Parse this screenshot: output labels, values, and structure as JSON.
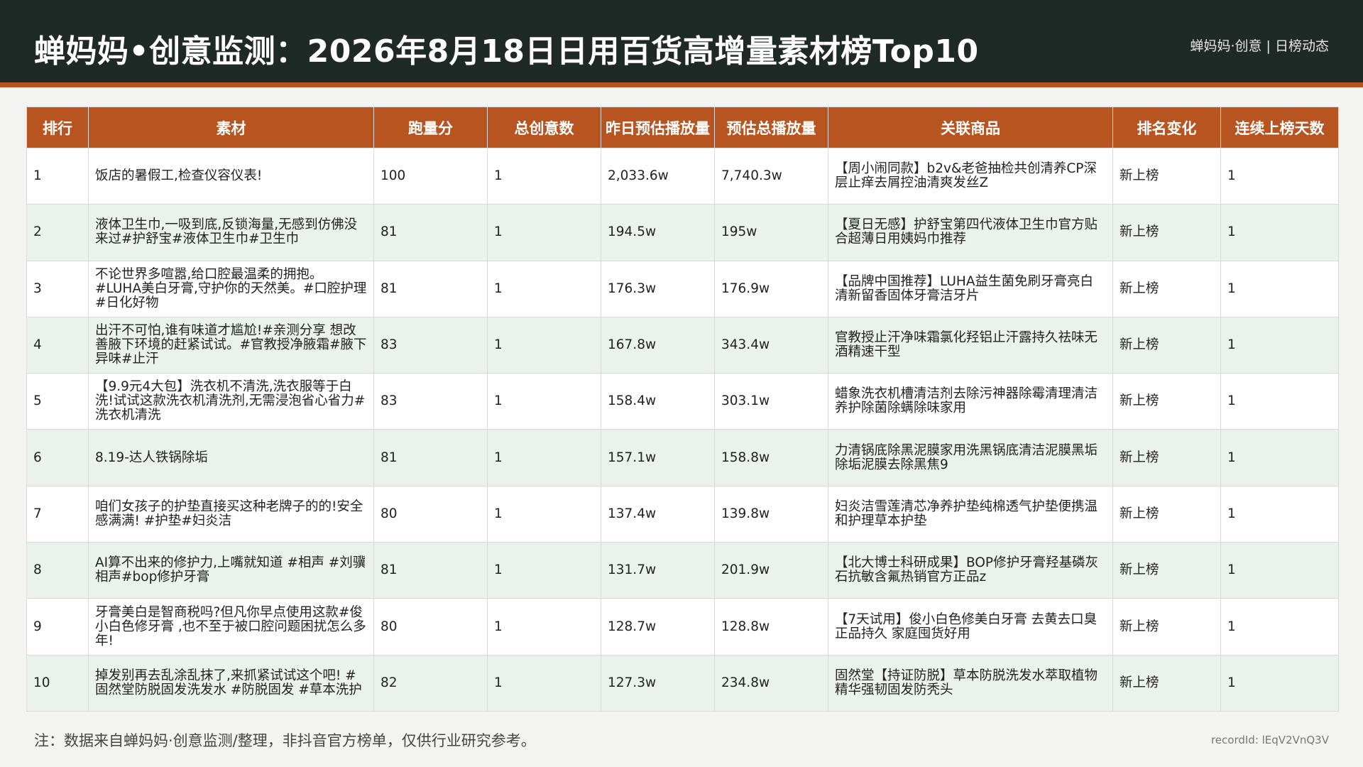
{
  "header": {
    "title": "蝉妈妈•创意监测：2026年8月18日日用百货高增量素材榜Top10",
    "right": "蝉妈妈·创意 | 日榜动态"
  },
  "table": {
    "columns": [
      "排行",
      "素材",
      "跑量分",
      "总创意数",
      "昨日预估播放量",
      "预估总播放量",
      "关联商品",
      "排名变化",
      "连续上榜天数"
    ],
    "rows": [
      {
        "rank": "1",
        "material": "饭店的暑假工,检查仪容仪表!",
        "score": "100",
        "creatives": "1",
        "yesterday_plays": "2,033.6w",
        "total_plays": "7,740.3w",
        "product": "【周小闹同款】b2v&老爸抽检共创清养CP深层止痒去屑控油清爽发丝Z",
        "rank_change": "新上榜",
        "streak_days": "1"
      },
      {
        "rank": "2",
        "material": "液体卫生巾,一吸到底,反锁海量,无感到仿佛没来过#护舒宝#液体卫生巾#卫生巾",
        "score": "81",
        "creatives": "1",
        "yesterday_plays": "194.5w",
        "total_plays": "195w",
        "product": "【夏日无感】护舒宝第四代液体卫生巾官方贴合超薄日用姨妈巾推荐",
        "rank_change": "新上榜",
        "streak_days": "1"
      },
      {
        "rank": "3",
        "material": "不论世界多喧嚣,给口腔最温柔的拥抱。#LUHA美白牙膏,守护你的天然美。#口腔护理 #日化好物",
        "score": "81",
        "creatives": "1",
        "yesterday_plays": "176.3w",
        "total_plays": "176.9w",
        "product": "【品牌中国推荐】LUHA益生菌免刷牙膏亮白清新留香固体牙膏洁牙片",
        "rank_change": "新上榜",
        "streak_days": "1"
      },
      {
        "rank": "4",
        "material": "出汗不可怕,谁有味道才尴尬!#亲测分享 想改善腋下环境的赶紧试试。#官教授净腋霜#腋下异味#止汗",
        "score": "83",
        "creatives": "1",
        "yesterday_plays": "167.8w",
        "total_plays": "343.4w",
        "product": "官教授止汗净味霜氯化羟铝止汗露持久祛味无酒精速干型",
        "rank_change": "新上榜",
        "streak_days": "1"
      },
      {
        "rank": "5",
        "material": "【9.9元4大包】洗衣机不清洗,洗衣服等于白洗!试试这款洗衣机清洗剂,无需浸泡省心省力#洗衣机清洗",
        "score": "83",
        "creatives": "1",
        "yesterday_plays": "158.4w",
        "total_plays": "303.1w",
        "product": "蜡象洗衣机槽清洁剂去除污神器除霉清理清洁养护除菌除螨除味家用",
        "rank_change": "新上榜",
        "streak_days": "1"
      },
      {
        "rank": "6",
        "material": "8.19-达人铁锅除垢",
        "score": "81",
        "creatives": "1",
        "yesterday_plays": "157.1w",
        "total_plays": "158.8w",
        "product": "力清锅底除黑泥膜家用洗黑锅底清洁泥膜黑垢除垢泥膜去除黑焦9",
        "rank_change": "新上榜",
        "streak_days": "1"
      },
      {
        "rank": "7",
        "material": "咱们女孩子的护垫直接买这种老牌子的的!安全感满满! #护垫#妇炎洁",
        "score": "80",
        "creatives": "1",
        "yesterday_plays": "137.4w",
        "total_plays": "139.8w",
        "product": "妇炎洁雪莲清芯净养护垫纯棉透气护垫便携温和护理草本护垫",
        "rank_change": "新上榜",
        "streak_days": "1"
      },
      {
        "rank": "8",
        "material": "AI算不出来的修护力,上嘴就知道 #相声 #刘骥相声#bop修护牙膏",
        "score": "81",
        "creatives": "1",
        "yesterday_plays": "131.7w",
        "total_plays": "201.9w",
        "product": "【北大博士科研成果】BOP修护牙膏羟基磷灰石抗敏含氟热销官方正品z",
        "rank_change": "新上榜",
        "streak_days": "1"
      },
      {
        "rank": "9",
        "material": "牙膏美白是智商税吗?但凡你早点使用这款#俊小白色修牙膏 ,也不至于被口腔问题困扰怎么多年!",
        "score": "80",
        "creatives": "1",
        "yesterday_plays": "128.7w",
        "total_plays": "128.8w",
        "product": "【7天试用】俊小白色修美白牙膏 去黄去口臭正品持久 家庭囤货好用",
        "rank_change": "新上榜",
        "streak_days": "1"
      },
      {
        "rank": "10",
        "material": "掉发别再去乱涂乱抹了,来抓紧试试这个吧! #固然堂防脱固发洗发水 #防脱固发 #草本洗护",
        "score": "82",
        "creatives": "1",
        "yesterday_plays": "127.3w",
        "total_plays": "234.8w",
        "product": "固然堂【持证防脱】草本防脱洗发水萃取植物精华强韧固发防秃头",
        "rank_change": "新上榜",
        "streak_days": "1"
      }
    ]
  },
  "footer": {
    "note": "注：数据来自蝉妈妈·创意监测/整理，非抖音官方榜单，仅供行业研究参考。",
    "record_id": "recordId: lEqV2VnQ3V"
  },
  "colors": {
    "header_bg": "#1f2a26",
    "accent": "#b85420",
    "row_alt": "#ebf1ec"
  }
}
